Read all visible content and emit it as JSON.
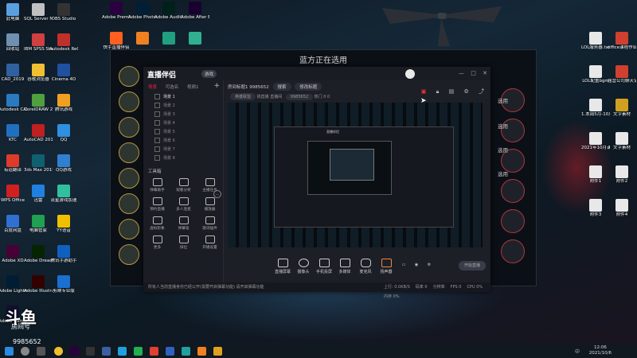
{
  "desktop": {
    "icons_left": [
      {
        "label": "此电脑",
        "color": "#5aa0e0"
      },
      {
        "label": "SQL Server Manage...",
        "color": "#c0c0c0"
      },
      {
        "label": "OBS Studio",
        "color": "#333333"
      },
      {
        "label": "回收站",
        "color": "#7090b0"
      },
      {
        "label": "IBM SPSS Statistics 21",
        "color": "#d04040"
      },
      {
        "label": "Autodesk ReCap",
        "color": "#c0302a"
      },
      {
        "label": "CAD_2019",
        "color": "#3060a0"
      },
      {
        "label": "谷歌浏览器",
        "color": "#f0c030"
      },
      {
        "label": "Cinema 4D",
        "color": "#2050a0"
      },
      {
        "label": "Autodesk CAD 2019",
        "color": "#2a7ac0"
      },
      {
        "label": "CorelDRAW 2019",
        "color": "#50a040"
      },
      {
        "label": "腾讯游戏",
        "color": "#f0a020"
      },
      {
        "label": "KTC",
        "color": "#2070c0"
      },
      {
        "label": "AutoCAD 2018",
        "color": "#c02020"
      },
      {
        "label": "QQ",
        "color": "#3090e0"
      },
      {
        "label": "有道翻译",
        "color": "#e03a2a"
      },
      {
        "label": "3ds Max 2019",
        "color": "#106070"
      },
      {
        "label": "QQ游戏",
        "color": "#3080d0"
      },
      {
        "label": "WPS Office",
        "color": "#d02020"
      },
      {
        "label": "迅雷",
        "color": "#2080e0"
      },
      {
        "label": "流星游戏加速",
        "color": "#30c0a0"
      },
      {
        "label": "百度网盘",
        "color": "#3070d0"
      },
      {
        "label": "电脑管家",
        "color": "#20a050"
      },
      {
        "label": "YY语音",
        "color": "#f0c000"
      },
      {
        "label": "Adobe XD",
        "color": "#470137"
      },
      {
        "label": "Adobe Dreamwe...",
        "color": "#072401"
      },
      {
        "label": "腾讯手游助手",
        "color": "#1060c0"
      },
      {
        "label": "Adobe Lightroo...",
        "color": "#001d34"
      },
      {
        "label": "Adobe Illustrat...",
        "color": "#330000"
      },
      {
        "label": "剪映专业版",
        "color": "#1a6fd0"
      },
      {
        "label": "Adobe Camera...",
        "color": "#101030"
      }
    ],
    "icons_top": [
      {
        "label": "Adobe Premie...",
        "color": "#2a0040"
      },
      {
        "label": "Adobe Photosh...",
        "color": "#001e36"
      },
      {
        "label": "Adobe Auditi...",
        "color": "#00201a"
      },
      {
        "label": "Adobe After Effects CC ...",
        "color": "#1a0030"
      },
      {
        "label": "快手直播伴侣",
        "color": "#ff6020"
      },
      {
        "label": "",
        "color": "#f08020"
      },
      {
        "label": "",
        "color": "#20a080"
      },
      {
        "label": "",
        "color": "#30b090"
      }
    ],
    "icons_right": [
      {
        "label": "LOL服务器.txt",
        "color": "#e8e8e8"
      },
      {
        "label": "office课程作业",
        "color": "#d04030"
      },
      {
        "label": "LOL配置bgm",
        "color": "#e8e8e8"
      },
      {
        "label": "届营公司聊天记录PPT",
        "color": "#d04030"
      },
      {
        "label": "1.本周5月-10月直播脚本",
        "color": "#e8e8e8"
      },
      {
        "label": "文字素材",
        "color": "#d0a020"
      },
      {
        "label": "2021年10月课程",
        "color": "#e8e8e8"
      },
      {
        "label": "文字素材",
        "color": "#e8e8e8"
      },
      {
        "label": "附件1",
        "color": "#e8e8e8"
      },
      {
        "label": "附件2",
        "color": "#e8e8e8"
      },
      {
        "label": "附件3",
        "color": "#e8e8e8"
      },
      {
        "label": "附件4",
        "color": "#e8e8e8"
      }
    ]
  },
  "game_client": {
    "title": "蓝方正在选用",
    "right_labels": [
      "选用",
      "选用",
      "选用",
      "选用"
    ]
  },
  "app": {
    "logo": "直播伴侣",
    "version": "游戏",
    "window_controls": [
      "—",
      "□",
      "✕"
    ],
    "sidebar_tabs": [
      "场景",
      "可选名",
      "视频1"
    ],
    "active_tab": 0,
    "scenes": [
      "场景 1",
      "场景 2",
      "场景 3",
      "场景 4",
      "场景 5",
      "场景 6",
      "场景 7",
      "场景 8"
    ],
    "active_scene": "场景 1",
    "tools_title": "工具箱",
    "tools": [
      {
        "label": "弹幕助手"
      },
      {
        "label": "观看分析"
      },
      {
        "label": "主播任务"
      },
      {
        "label": "预约直播"
      },
      {
        "label": "多人连麦"
      },
      {
        "label": "播放器"
      },
      {
        "label": "虚拟形象"
      },
      {
        "label": "弹幕墙"
      },
      {
        "label": "歌词插件"
      },
      {
        "label": "更多"
      },
      {
        "label": "排位"
      },
      {
        "label": "开播设置"
      }
    ],
    "room": {
      "label": "房间标题1",
      "id": "9985652",
      "pill1": "搜索",
      "pill2": "修改标题",
      "category": "英雄联盟",
      "sub1": "搞直播 直播间",
      "sub2": "9985652",
      "sub3": "热门 0",
      "sub4": "0"
    },
    "preview_title": "直播伴侣",
    "controls": [
      {
        "label": "直播屏幕"
      },
      {
        "label": "摄像头"
      },
      {
        "label": "手机投屏"
      },
      {
        "label": "多媒体"
      },
      {
        "label": "麦克风"
      },
      {
        "label": "扬声器"
      }
    ],
    "go_live": "开始直播",
    "status_left": "所有人当前直播身份已经公开(需要开启弹幕功能) 请开启弹幕功能",
    "status_right": [
      "上行: 0.0KB/S",
      "码率 0",
      "分辨率",
      "FPS 0",
      "CPU 0%",
      "内存 0%"
    ]
  },
  "overlay": {
    "brand": "斗鱼",
    "room_label": "房间号",
    "room_id": "9985652"
  },
  "taskbar": {
    "time": "12:06",
    "date": "2021/10/6",
    "lang": "中"
  }
}
